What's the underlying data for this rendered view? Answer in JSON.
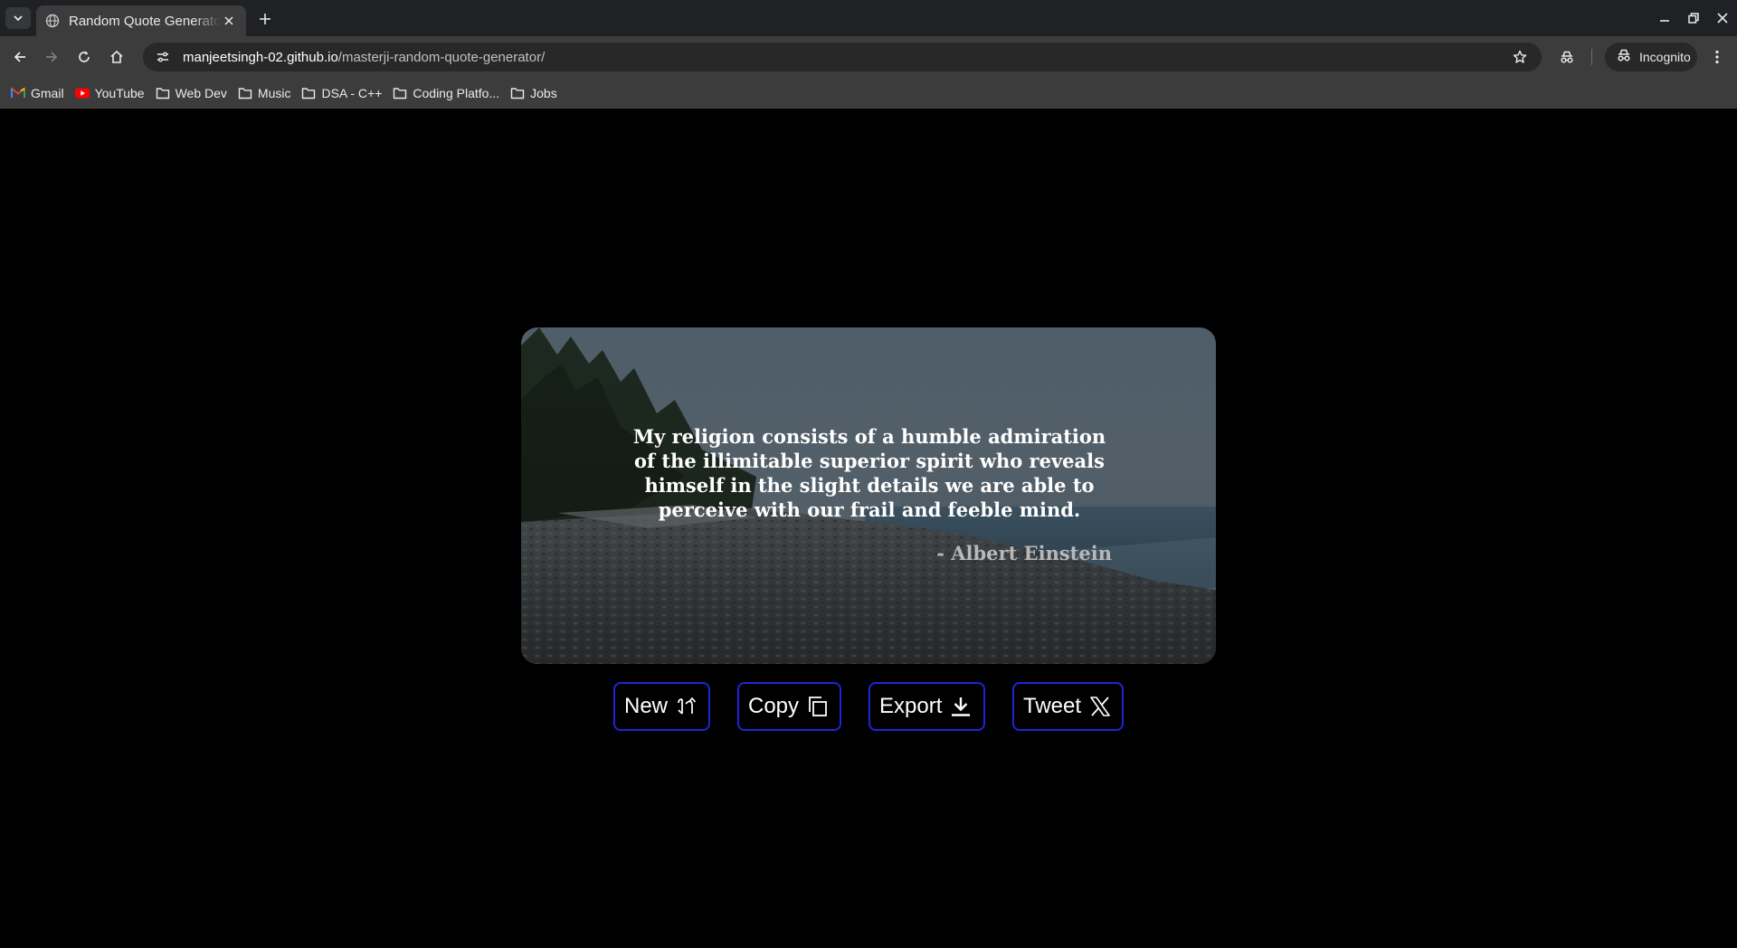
{
  "browser": {
    "tab_title": "Random Quote Generator",
    "url_host": "manjeetsingh-02.github.io",
    "url_path": "/masterji-random-quote-generator/",
    "incognito_label": "Incognito",
    "bookmarks": [
      {
        "label": "Gmail",
        "icon": "gmail-icon"
      },
      {
        "label": "YouTube",
        "icon": "youtube-icon"
      },
      {
        "label": "Web Dev",
        "icon": "folder-icon"
      },
      {
        "label": "Music",
        "icon": "folder-icon"
      },
      {
        "label": "DSA - C++",
        "icon": "folder-icon"
      },
      {
        "label": "Coding Platfo...",
        "icon": "folder-icon"
      },
      {
        "label": "Jobs",
        "icon": "folder-icon"
      }
    ]
  },
  "quote_card": {
    "quote_text": "My religion consists of a humble admiration of the illimitable superior spirit who reveals himself in the slight details we are able to perceive with our frail and feeble mind.",
    "author": "- Albert Einstein"
  },
  "actions": {
    "new_label": "New",
    "copy_label": "Copy",
    "export_label": "Export",
    "tweet_label": "Tweet"
  },
  "colors": {
    "button_border": "#1f23d9",
    "page_background": "#000000",
    "chrome_toolbar": "#3c3c3c"
  }
}
